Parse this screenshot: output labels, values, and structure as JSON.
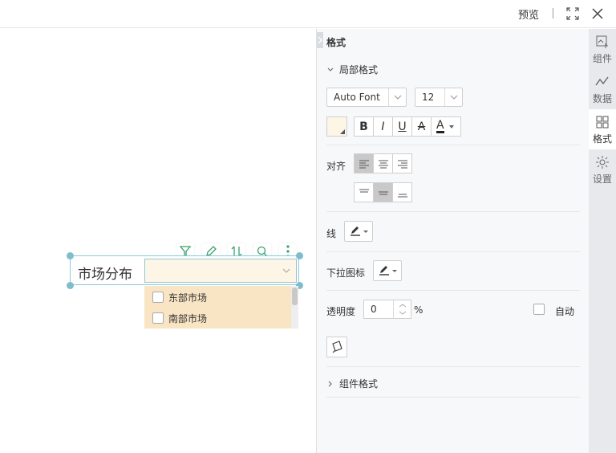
{
  "topbar": {
    "preview_label": "预览",
    "fullscreen_icon": "fullscreen-icon",
    "close_icon": "close-icon"
  },
  "widget": {
    "label": "市场分布",
    "combo_value": "",
    "options": [
      {
        "label": "东部市场",
        "checked": false
      },
      {
        "label": "南部市场",
        "checked": false
      }
    ],
    "mini_toolbar": [
      "filter-icon",
      "edit-icon",
      "sort-icon",
      "search-icon",
      "more-icon"
    ]
  },
  "panel": {
    "title": "格式",
    "local_format": "局部格式",
    "font_family": "Auto Font",
    "font_size": "12",
    "style_buttons": [
      "B",
      "I",
      "U",
      "A",
      "A"
    ],
    "align_label": "对齐",
    "line_label": "线",
    "dropdown_icon_label": "下拉图标",
    "opacity_label": "透明度",
    "opacity_value": "0",
    "opacity_unit": "%",
    "auto_label": "自动",
    "component_format": "组件格式"
  },
  "rail": {
    "items": [
      {
        "label": "组件",
        "icon": "component-icon"
      },
      {
        "label": "数据",
        "icon": "data-icon"
      },
      {
        "label": "格式",
        "icon": "format-icon",
        "active": true
      },
      {
        "label": "设置",
        "icon": "settings-icon"
      }
    ]
  },
  "colors": {
    "widget_border": "#8cc8d6",
    "combo_bg": "#fdf5e6",
    "dropdown_bg": "#f9e5c4",
    "toolbar_green": "#3aa06a"
  }
}
